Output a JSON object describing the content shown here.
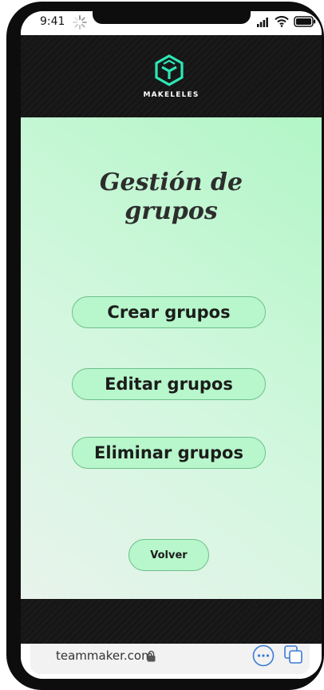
{
  "status_bar": {
    "time": "9:41"
  },
  "header": {
    "brand": "MAKELELES"
  },
  "page": {
    "title_line1": "Gestión de",
    "title_line2": "grupos"
  },
  "menu": {
    "create_label": "Crear grupos",
    "edit_label": "Editar grupos",
    "delete_label": "Eliminar grupos",
    "back_label": "Volver"
  },
  "browser": {
    "url": "teammaker.com"
  },
  "colors": {
    "accent": "#2ee6b6",
    "button_fill": "#b7f7cb",
    "button_border": "#6fbf8a",
    "browser_icon": "#3a7bd5"
  }
}
